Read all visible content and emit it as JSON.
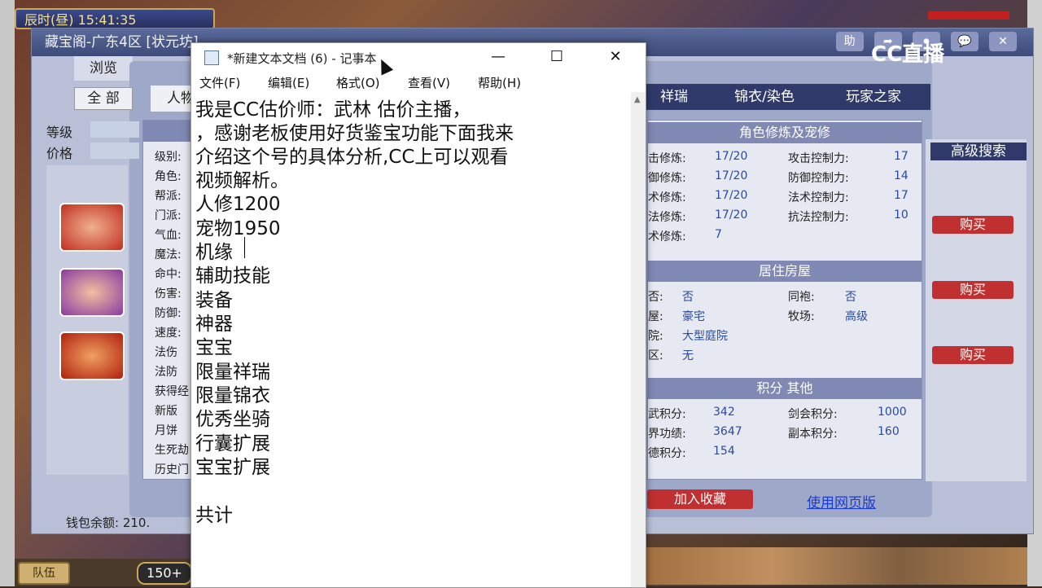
{
  "game": {
    "status_time": "辰时(昼) 15:41:35",
    "team_label": "队伍",
    "level_box": "150+",
    "watermark": "CC直播"
  },
  "treasure_window": {
    "title": "藏宝阁-广东4区 [状元坊]",
    "title_buttons": [
      "助",
      "➦",
      "⏺",
      "💬",
      "✕"
    ],
    "browse_tab": "浏览",
    "all_tab": "全 部",
    "role_tab": "人物",
    "level_label": "等级",
    "price_label": "价格",
    "wallet_label": "钱包余额: 210.",
    "left_labels": [
      "级别:",
      "角色:",
      "帮派:",
      "门派:",
      "气血:",
      "魔法:",
      "命中:",
      "伤害:",
      "防御:",
      "速度:",
      "法伤",
      "法防",
      "获得经",
      "新版",
      "月饼",
      "生死劫",
      "历史门"
    ],
    "right_tabs": [
      "祥瑞",
      "锦衣/染色",
      "玩家之家"
    ],
    "cultivation": {
      "header": "角色修炼及宠修",
      "rows": [
        {
          "label": "击修炼:",
          "value": "17/20",
          "label2": "攻击控制力:",
          "value2": "17"
        },
        {
          "label": "御修炼:",
          "value": "17/20",
          "label2": "防御控制力:",
          "value2": "14"
        },
        {
          "label": "术修炼:",
          "value": "17/20",
          "label2": "法术控制力:",
          "value2": "17"
        },
        {
          "label": "法修炼:",
          "value": "17/20",
          "label2": "抗法控制力:",
          "value2": "10"
        },
        {
          "label": "术修炼:",
          "value": "7",
          "label2": "",
          "value2": ""
        }
      ]
    },
    "house": {
      "header": "居住房屋",
      "rows": [
        {
          "label": "否:",
          "value": "否",
          "label2": "同袍:",
          "value2": "否"
        },
        {
          "label": "屋:",
          "value": "豪宅",
          "label2": "牧场:",
          "value2": "高级"
        },
        {
          "label": "院:",
          "value": "大型庭院",
          "label2": "",
          "value2": ""
        },
        {
          "label": "区:",
          "value": "无",
          "label2": "",
          "value2": ""
        }
      ]
    },
    "points": {
      "header": "积分 其他",
      "rows": [
        {
          "label": "武积分:",
          "value": "342",
          "label2": "剑会积分:",
          "value2": "1000"
        },
        {
          "label": "界功绩:",
          "value": "3647",
          "label2": "副本积分:",
          "value2": "160"
        },
        {
          "label": "德积分:",
          "value": "154",
          "label2": "",
          "value2": ""
        }
      ]
    },
    "collect_button": "加入收藏",
    "web_link": "使用网页版",
    "advanced_search": "高级搜索",
    "buy_buttons": [
      "购买",
      "购买",
      "购买"
    ]
  },
  "notepad": {
    "title": "*新建文本文档 (6) - 记事本",
    "menu": [
      "文件(F)",
      "编辑(E)",
      "格式(O)",
      "查看(V)",
      "帮助(H)"
    ],
    "lines": [
      "我是CC估价师：武林 估价主播，",
      "，感谢老板使用好货鉴宝功能下面我来",
      "介绍这个号的具体分析,CC上可以观看",
      "视频解析。",
      "人修1200",
      "宠物1950",
      "机缘",
      "辅助技能",
      "装备",
      "神器",
      "宝宝",
      "限量祥瑞",
      "限量锦衣",
      "优秀坐骑",
      "行囊扩展",
      "宝宝扩展",
      "",
      "共计"
    ]
  }
}
